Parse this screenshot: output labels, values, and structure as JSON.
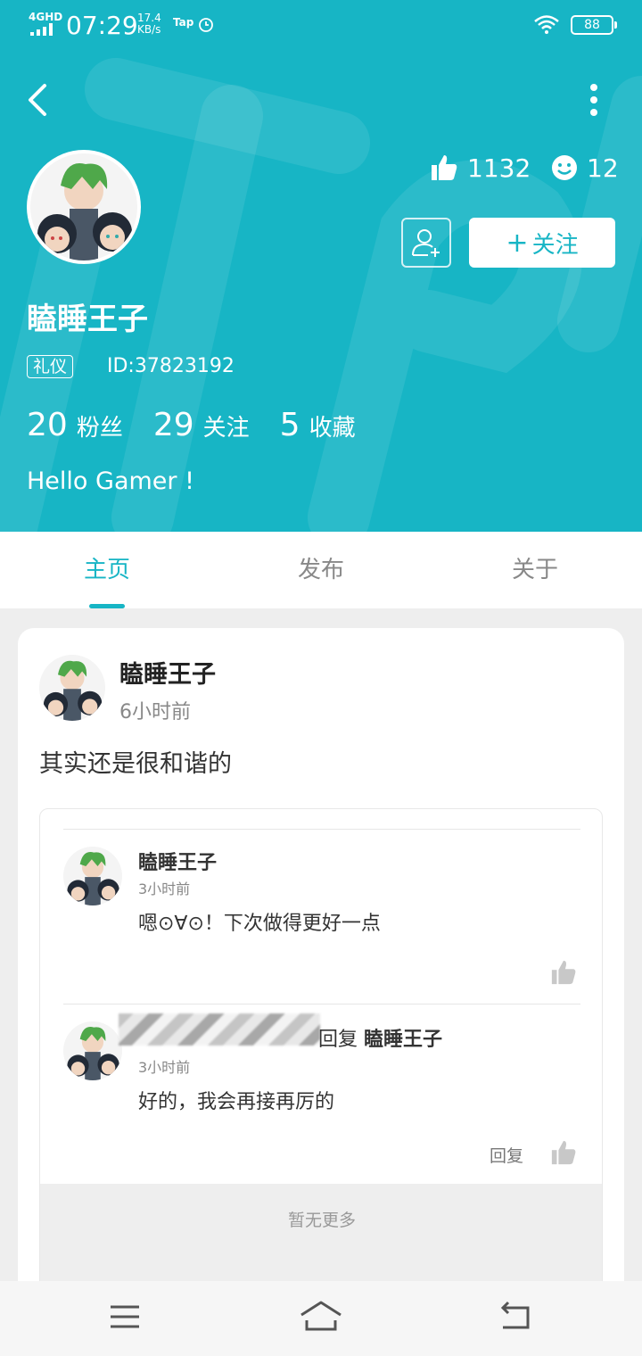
{
  "status_bar": {
    "network": "4GHD",
    "time": "07:29",
    "speed_value": "17.4",
    "speed_unit": "KB/s",
    "tap": "Tap",
    "battery": "88"
  },
  "profile": {
    "name": "瞌睡王子",
    "badge": "礼仪",
    "id": "ID:37823192",
    "likes": "1132",
    "smiles": "12",
    "follow_label": "关注",
    "follow_plus": "+",
    "fans_count": "20",
    "fans_label": "粉丝",
    "following_count": "29",
    "following_label": "关注",
    "fav_count": "5",
    "fav_label": "收藏",
    "bio": "Hello Gamer !"
  },
  "tabs": [
    {
      "label": "主页",
      "active": true
    },
    {
      "label": "发布",
      "active": false
    },
    {
      "label": "关于",
      "active": false
    }
  ],
  "post": {
    "author": "瞌睡王子",
    "time": "6小时前",
    "content": "其实还是很和谐的",
    "comments": [
      {
        "author": "瞌睡王子",
        "time": "3小时前",
        "text": "嗯⊙∀⊙！下次做得更好一点"
      },
      {
        "reply_word": "回复",
        "reply_to": "瞌睡王子",
        "time": "3小时前",
        "text": "好的，我会再接再厉的",
        "reply_btn": "回复"
      }
    ],
    "no_more": "暂无更多"
  },
  "colors": {
    "accent": "#17b5c5"
  }
}
